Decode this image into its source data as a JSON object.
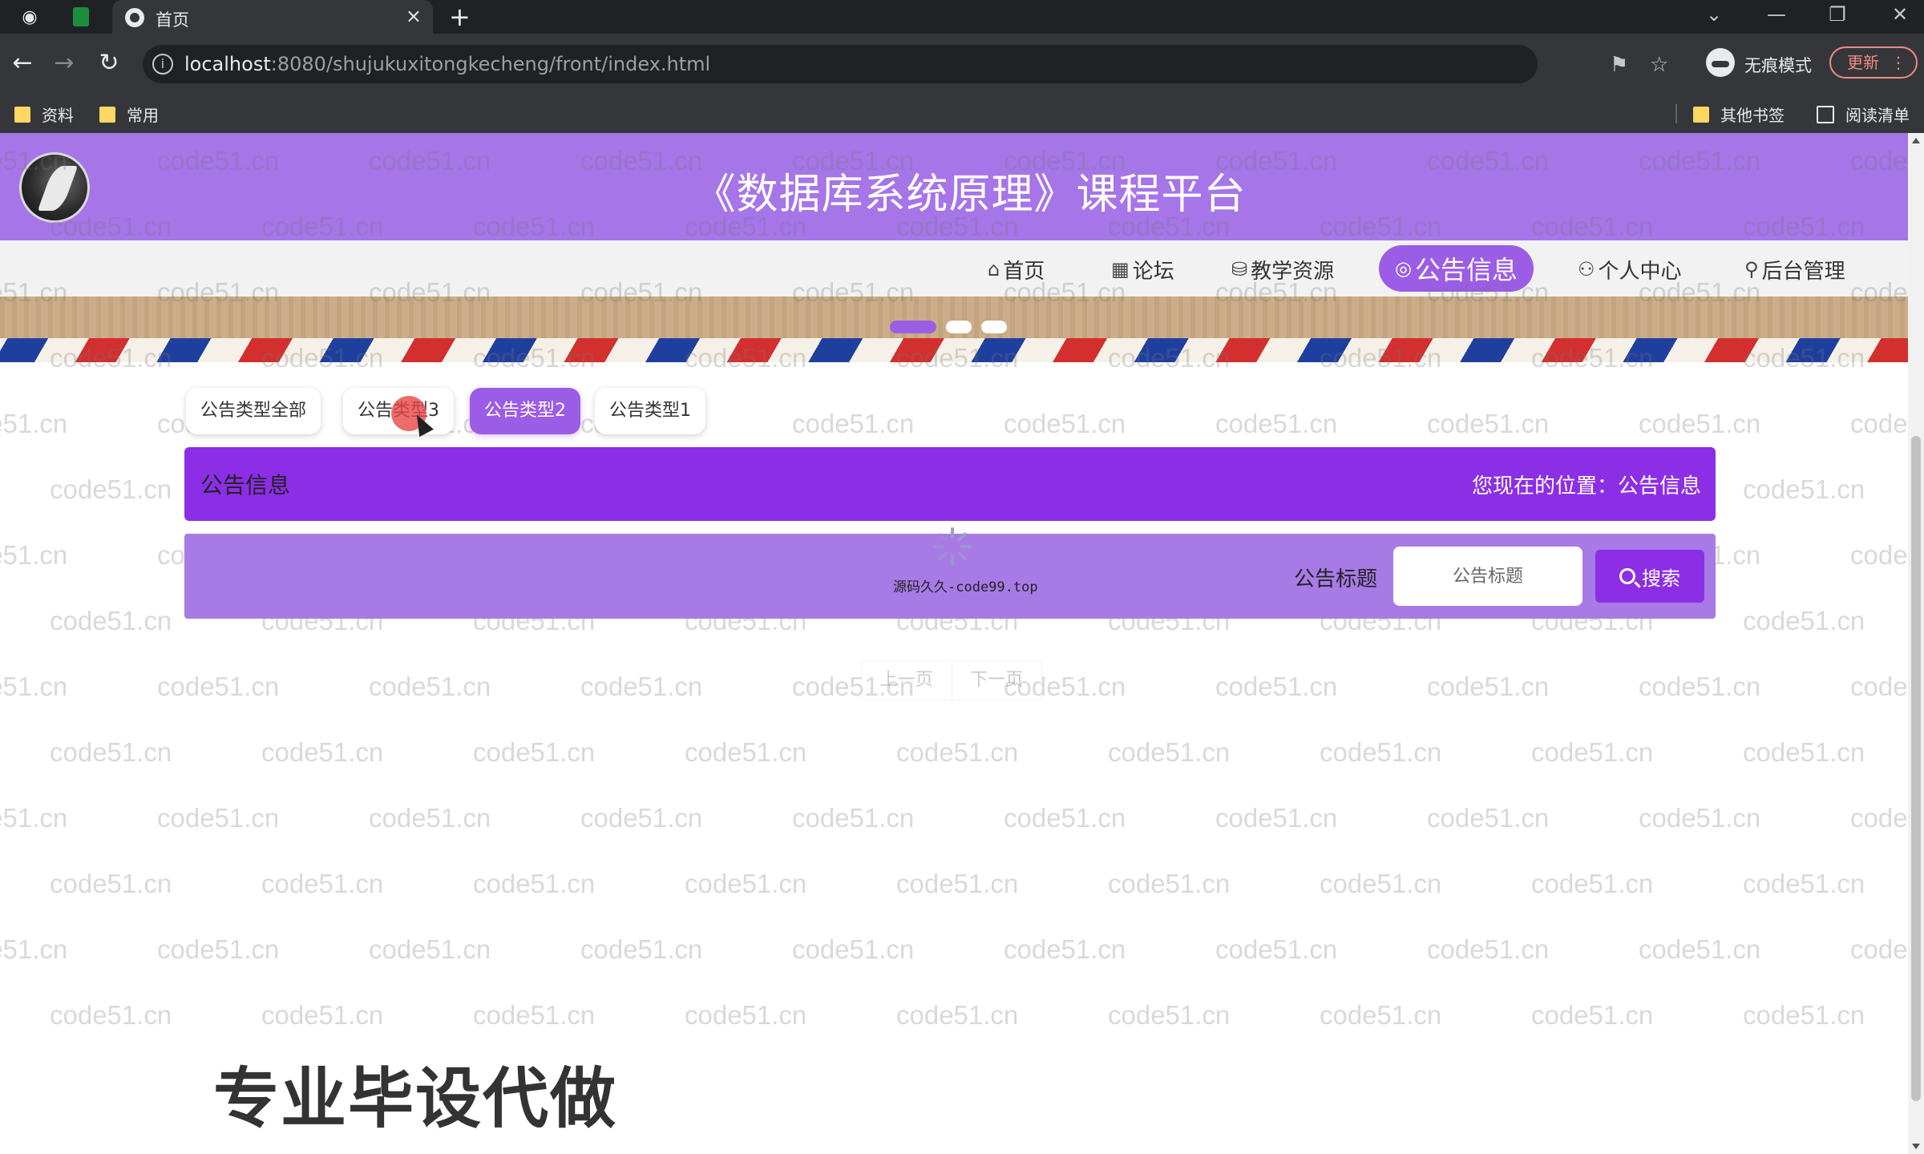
{
  "browser": {
    "tab_title": "首页",
    "url_host": "localhost",
    "url_path": ":8080/shujukuxitongkecheng/front/index.html",
    "incognito_label": "无痕模式",
    "update_label": "更新",
    "bookmarks": [
      "资料",
      "常用"
    ],
    "other_bookmarks": "其他书签",
    "reading_list": "阅读清单"
  },
  "site": {
    "title": "《数据库系统原理》课程平台"
  },
  "nav": [
    {
      "label": "首页",
      "icon": "home-icon",
      "glyph": "⌂"
    },
    {
      "label": "论坛",
      "icon": "forum-icon",
      "glyph": "▦"
    },
    {
      "label": "教学资源",
      "icon": "resource-icon",
      "glyph": "⛁"
    },
    {
      "label": "公告信息",
      "icon": "notice-icon",
      "glyph": "◎",
      "active": true
    },
    {
      "label": "个人中心",
      "icon": "user-icon",
      "glyph": "⚇"
    },
    {
      "label": "后台管理",
      "icon": "link-icon",
      "glyph": "⚲"
    }
  ],
  "filters": [
    "公告类型全部",
    "公告类型3",
    "公告类型2",
    "公告类型1"
  ],
  "active_filter": "公告类型2",
  "section": {
    "title": "公告信息",
    "breadcrumb": "您现在的位置：公告信息"
  },
  "search": {
    "label": "公告标题",
    "placeholder": "公告标题",
    "button": "搜索"
  },
  "loading": {
    "text": "源码久久-code99.top"
  },
  "pager": {
    "prev": "上一页",
    "next": "下一页"
  },
  "watermark": "code51.cn",
  "promo": "专业毕设代做",
  "colors": {
    "header": "#a675e8",
    "accent": "#9b5ce6",
    "section_bar": "#8c2ee6"
  }
}
